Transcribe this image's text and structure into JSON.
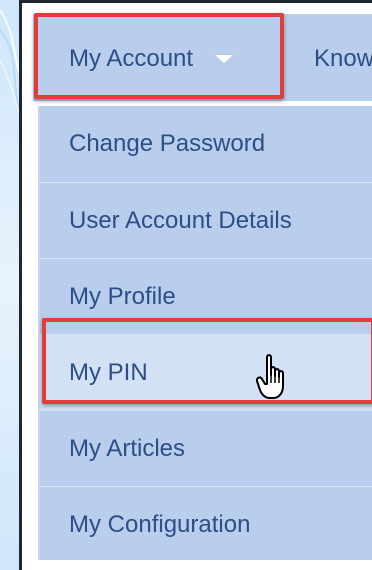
{
  "topnav": {
    "my_account_label": "My Account",
    "next_item_label": "Know"
  },
  "dropdown": {
    "items": [
      {
        "label": "Change Password"
      },
      {
        "label": "User Account Details"
      },
      {
        "label": "My Profile"
      },
      {
        "label": "My PIN"
      },
      {
        "label": "My Articles"
      },
      {
        "label": "My Configuration"
      }
    ]
  },
  "colors": {
    "menu_bg": "#b9cdec",
    "hover_bg": "#d3e1f5",
    "text": "#2b4f86",
    "highlight": "#e43b3b"
  },
  "icons": {
    "caret": "caret-down-icon",
    "cursor": "hand-pointer-icon"
  }
}
